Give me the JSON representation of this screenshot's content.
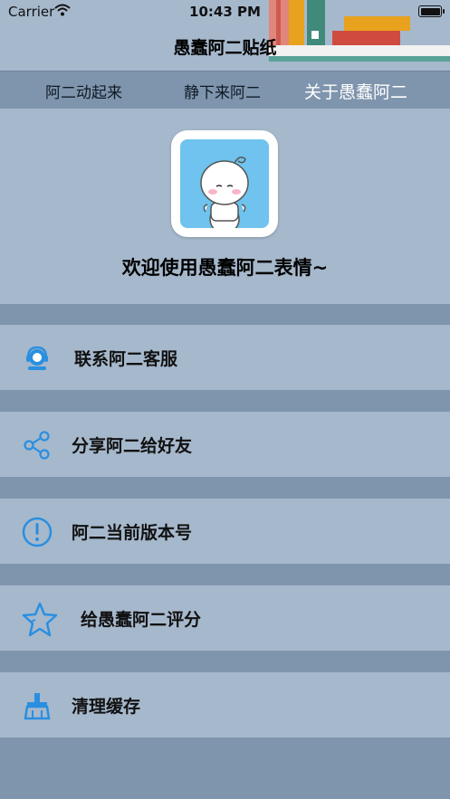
{
  "status_bar": {
    "carrier": "Carrier",
    "time": "10:43 PM"
  },
  "nav": {
    "title": "愚蠢阿二贴纸"
  },
  "tabs": [
    {
      "label": "阿二动起来"
    },
    {
      "label": "静下来阿二"
    },
    {
      "label": "关于愚蠢阿二"
    }
  ],
  "about": {
    "welcome": "欢迎使用愚蠢阿二表情~"
  },
  "menu": [
    {
      "label": "联系阿二客服",
      "icon": "customer-service-icon"
    },
    {
      "label": "分享阿二给好友",
      "icon": "share-icon"
    },
    {
      "label": "阿二当前版本号",
      "icon": "info-icon"
    },
    {
      "label": "给愚蠢阿二评分",
      "icon": "star-icon"
    },
    {
      "label": "清理缓存",
      "icon": "broom-icon"
    }
  ],
  "colors": {
    "accent": "#2a8fe0",
    "background": "#7f95ad",
    "card": "#a6b8cc"
  }
}
